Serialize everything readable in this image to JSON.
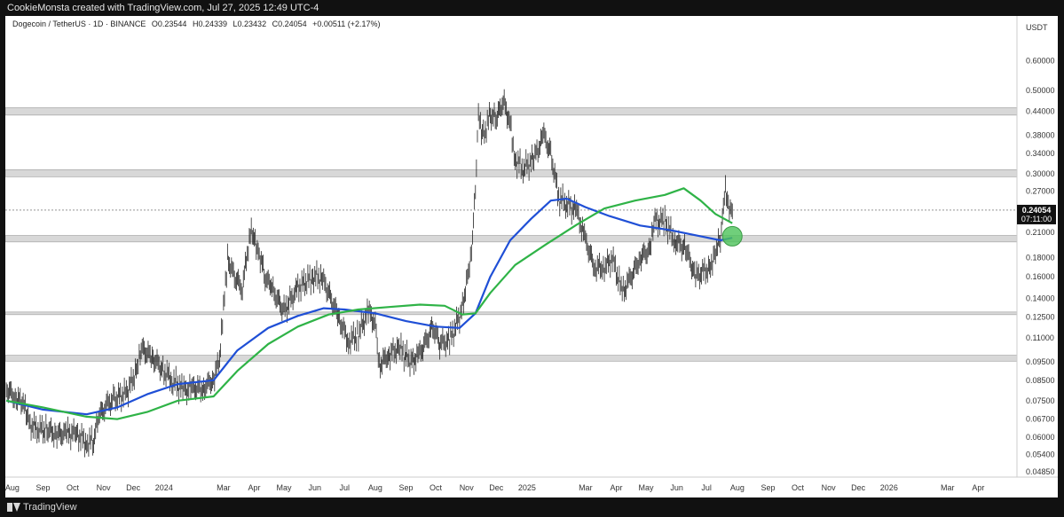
{
  "header": {
    "caption": "CookieMonsta created with TradingView.com, Jul 27, 2025 12:49 UTC-4"
  },
  "footer": {
    "brand": "TradingView"
  },
  "legend": {
    "symbol": "Dogecoin / TetherUS · 1D · BINANCE",
    "open": "O0.23544",
    "high": "H0.24339",
    "low": "L0.23432",
    "close": "C0.24054",
    "change": "+0.00511 (+2.17%)"
  },
  "price_tag": {
    "price": "0.24054",
    "countdown": "07:11:00"
  },
  "colors": {
    "ema_fast": "#1f4fd6",
    "ema_slow": "#2fb347",
    "marker": "#4cc35a",
    "zone": "#d8d8d8",
    "candles": "#222222"
  },
  "chart_data": {
    "type": "line",
    "scale": "log",
    "unit_label": "USDT",
    "ylim": [
      0.047,
      0.7
    ],
    "xlim": [
      "2023-07-25",
      "2026-05-10"
    ],
    "y_ticks": [
      0.6,
      0.5,
      0.44,
      0.38,
      0.34,
      0.3,
      0.27,
      0.21,
      0.18,
      0.16,
      0.14,
      0.125,
      0.11,
      0.095,
      0.085,
      0.075,
      0.067,
      0.06,
      0.054,
      0.0485
    ],
    "y_tick_labels": [
      "0.60000",
      "0.50000",
      "0.44000",
      "0.38000",
      "0.34000",
      "0.30000",
      "0.27000",
      "0.21000",
      "0.18000",
      "0.16000",
      "0.14000",
      "0.12500",
      "0.11000",
      "0.09500",
      "0.08500",
      "0.07500",
      "0.06700",
      "0.06000",
      "0.05400",
      "0.04850"
    ],
    "x_ticks": [
      {
        "date": "2023-08-01",
        "label": "Aug"
      },
      {
        "date": "2023-09-01",
        "label": "Sep"
      },
      {
        "date": "2023-10-01",
        "label": "Oct"
      },
      {
        "date": "2023-11-01",
        "label": "Nov"
      },
      {
        "date": "2023-12-01",
        "label": "Dec"
      },
      {
        "date": "2024-01-01",
        "label": "2024"
      },
      {
        "date": "2024-03-01",
        "label": "Mar"
      },
      {
        "date": "2024-04-01",
        "label": "Apr"
      },
      {
        "date": "2024-05-01",
        "label": "May"
      },
      {
        "date": "2024-06-01",
        "label": "Jun"
      },
      {
        "date": "2024-07-01",
        "label": "Jul"
      },
      {
        "date": "2024-08-01",
        "label": "Aug"
      },
      {
        "date": "2024-09-01",
        "label": "Sep"
      },
      {
        "date": "2024-10-01",
        "label": "Oct"
      },
      {
        "date": "2024-11-01",
        "label": "Nov"
      },
      {
        "date": "2024-12-01",
        "label": "Dec"
      },
      {
        "date": "2025-01-01",
        "label": "2025"
      },
      {
        "date": "2025-03-01",
        "label": "Mar"
      },
      {
        "date": "2025-04-01",
        "label": "Apr"
      },
      {
        "date": "2025-05-01",
        "label": "May"
      },
      {
        "date": "2025-06-01",
        "label": "Jun"
      },
      {
        "date": "2025-07-01",
        "label": "Jul"
      },
      {
        "date": "2025-08-01",
        "label": "Aug"
      },
      {
        "date": "2025-09-01",
        "label": "Sep"
      },
      {
        "date": "2025-10-01",
        "label": "Oct"
      },
      {
        "date": "2025-11-01",
        "label": "Nov"
      },
      {
        "date": "2025-12-01",
        "label": "Dec"
      },
      {
        "date": "2026-01-01",
        "label": "2026"
      },
      {
        "date": "2026-03-01",
        "label": "Mar"
      },
      {
        "date": "2026-04-01",
        "label": "Apr"
      }
    ],
    "zones": [
      {
        "low": 0.43,
        "high": 0.45
      },
      {
        "low": 0.295,
        "high": 0.308
      },
      {
        "low": 0.198,
        "high": 0.206
      },
      {
        "low": 0.127,
        "high": 0.129
      },
      {
        "low": 0.0955,
        "high": 0.099
      }
    ],
    "last_price": 0.24054,
    "price_series": [
      [
        "2023-07-26",
        0.081
      ],
      [
        "2023-08-05",
        0.076
      ],
      [
        "2023-08-12",
        0.074
      ],
      [
        "2023-08-17",
        0.066
      ],
      [
        "2023-08-25",
        0.063
      ],
      [
        "2023-09-05",
        0.063
      ],
      [
        "2023-09-15",
        0.061
      ],
      [
        "2023-09-25",
        0.0615
      ],
      [
        "2023-10-05",
        0.0615
      ],
      [
        "2023-10-15",
        0.058
      ],
      [
        "2023-10-22",
        0.059
      ],
      [
        "2023-10-28",
        0.069
      ],
      [
        "2023-11-05",
        0.073
      ],
      [
        "2023-11-12",
        0.076
      ],
      [
        "2023-11-25",
        0.079
      ],
      [
        "2023-12-05",
        0.092
      ],
      [
        "2023-12-10",
        0.103
      ],
      [
        "2023-12-20",
        0.098
      ],
      [
        "2024-01-01",
        0.09
      ],
      [
        "2024-01-10",
        0.085
      ],
      [
        "2024-01-20",
        0.08
      ],
      [
        "2024-01-30",
        0.081
      ],
      [
        "2024-02-10",
        0.081
      ],
      [
        "2024-02-20",
        0.086
      ],
      [
        "2024-02-26",
        0.096
      ],
      [
        "2024-03-01",
        0.13
      ],
      [
        "2024-03-05",
        0.18
      ],
      [
        "2024-03-12",
        0.16
      ],
      [
        "2024-03-20",
        0.15
      ],
      [
        "2024-03-28",
        0.21
      ],
      [
        "2024-04-01",
        0.2
      ],
      [
        "2024-04-05",
        0.19
      ],
      [
        "2024-04-12",
        0.16
      ],
      [
        "2024-04-18",
        0.15
      ],
      [
        "2024-05-01",
        0.13
      ],
      [
        "2024-05-15",
        0.15
      ],
      [
        "2024-05-30",
        0.16
      ],
      [
        "2024-06-08",
        0.16
      ],
      [
        "2024-06-15",
        0.145
      ],
      [
        "2024-06-25",
        0.125
      ],
      [
        "2024-07-05",
        0.108
      ],
      [
        "2024-07-15",
        0.113
      ],
      [
        "2024-07-25",
        0.13
      ],
      [
        "2024-08-01",
        0.12
      ],
      [
        "2024-08-05",
        0.093
      ],
      [
        "2024-08-15",
        0.1
      ],
      [
        "2024-08-25",
        0.104
      ],
      [
        "2024-09-06",
        0.095
      ],
      [
        "2024-09-15",
        0.1
      ],
      [
        "2024-09-28",
        0.118
      ],
      [
        "2024-10-05",
        0.107
      ],
      [
        "2024-10-15",
        0.108
      ],
      [
        "2024-10-27",
        0.13
      ],
      [
        "2024-11-02",
        0.16
      ],
      [
        "2024-11-06",
        0.19
      ],
      [
        "2024-11-10",
        0.27
      ],
      [
        "2024-11-13",
        0.42
      ],
      [
        "2024-11-18",
        0.38
      ],
      [
        "2024-11-25",
        0.43
      ],
      [
        "2024-12-01",
        0.42
      ],
      [
        "2024-12-08",
        0.47
      ],
      [
        "2024-12-15",
        0.41
      ],
      [
        "2024-12-20",
        0.33
      ],
      [
        "2024-12-28",
        0.31
      ],
      [
        "2025-01-08",
        0.33
      ],
      [
        "2025-01-18",
        0.38
      ],
      [
        "2025-01-25",
        0.34
      ],
      [
        "2025-02-02",
        0.26
      ],
      [
        "2025-02-10",
        0.25
      ],
      [
        "2025-02-20",
        0.24
      ],
      [
        "2025-03-01",
        0.2
      ],
      [
        "2025-03-10",
        0.17
      ],
      [
        "2025-03-20",
        0.17
      ],
      [
        "2025-03-28",
        0.18
      ],
      [
        "2025-04-07",
        0.145
      ],
      [
        "2025-04-15",
        0.158
      ],
      [
        "2025-04-25",
        0.18
      ],
      [
        "2025-05-05",
        0.19
      ],
      [
        "2025-05-10",
        0.225
      ],
      [
        "2025-05-20",
        0.225
      ],
      [
        "2025-05-30",
        0.2
      ],
      [
        "2025-06-10",
        0.19
      ],
      [
        "2025-06-20",
        0.16
      ],
      [
        "2025-06-28",
        0.165
      ],
      [
        "2025-07-05",
        0.17
      ],
      [
        "2025-07-10",
        0.19
      ],
      [
        "2025-07-15",
        0.2
      ],
      [
        "2025-07-18",
        0.24
      ],
      [
        "2025-07-20",
        0.27
      ],
      [
        "2025-07-23",
        0.25
      ],
      [
        "2025-07-27",
        0.24054
      ]
    ],
    "series": [
      {
        "name": "",
        "color": "#1f4fd6",
        "values": [
          [
            "2023-07-26",
            0.075
          ],
          [
            "2023-09-01",
            0.071
          ],
          [
            "2023-10-15",
            0.069
          ],
          [
            "2023-11-15",
            0.072
          ],
          [
            "2023-12-15",
            0.078
          ],
          [
            "2024-01-15",
            0.083
          ],
          [
            "2024-02-20",
            0.085
          ],
          [
            "2024-03-15",
            0.102
          ],
          [
            "2024-04-15",
            0.117
          ],
          [
            "2024-05-15",
            0.126
          ],
          [
            "2024-06-10",
            0.132
          ],
          [
            "2024-07-01",
            0.131
          ],
          [
            "2024-08-01",
            0.128
          ],
          [
            "2024-09-01",
            0.122
          ],
          [
            "2024-10-01",
            0.118
          ],
          [
            "2024-10-25",
            0.117
          ],
          [
            "2024-11-10",
            0.128
          ],
          [
            "2024-11-25",
            0.16
          ],
          [
            "2024-12-15",
            0.2
          ],
          [
            "2025-01-05",
            0.228
          ],
          [
            "2025-01-25",
            0.255
          ],
          [
            "2025-02-10",
            0.258
          ],
          [
            "2025-03-01",
            0.245
          ],
          [
            "2025-03-25",
            0.232
          ],
          [
            "2025-04-25",
            0.219
          ],
          [
            "2025-05-25",
            0.213
          ],
          [
            "2025-06-25",
            0.205
          ],
          [
            "2025-07-15",
            0.2
          ],
          [
            "2025-07-27",
            0.203
          ]
        ]
      },
      {
        "name": "",
        "color": "#2fb347",
        "values": [
          [
            "2023-07-26",
            0.075
          ],
          [
            "2023-09-01",
            0.072
          ],
          [
            "2023-10-15",
            0.068
          ],
          [
            "2023-11-15",
            0.067
          ],
          [
            "2023-12-15",
            0.07
          ],
          [
            "2024-01-15",
            0.075
          ],
          [
            "2024-02-20",
            0.077
          ],
          [
            "2024-03-15",
            0.09
          ],
          [
            "2024-04-15",
            0.106
          ],
          [
            "2024-05-15",
            0.118
          ],
          [
            "2024-06-15",
            0.127
          ],
          [
            "2024-07-15",
            0.131
          ],
          [
            "2024-08-15",
            0.133
          ],
          [
            "2024-09-15",
            0.135
          ],
          [
            "2024-10-10",
            0.134
          ],
          [
            "2024-10-28",
            0.127
          ],
          [
            "2024-11-10",
            0.128
          ],
          [
            "2024-11-25",
            0.145
          ],
          [
            "2024-12-20",
            0.172
          ],
          [
            "2025-01-20",
            0.195
          ],
          [
            "2025-02-20",
            0.22
          ],
          [
            "2025-03-20",
            0.243
          ],
          [
            "2025-04-20",
            0.255
          ],
          [
            "2025-05-20",
            0.264
          ],
          [
            "2025-06-08",
            0.275
          ],
          [
            "2025-06-25",
            0.255
          ],
          [
            "2025-07-10",
            0.235
          ],
          [
            "2025-07-27",
            0.222
          ]
        ]
      }
    ],
    "marker": {
      "date": "2025-07-27",
      "value": 0.205
    }
  }
}
